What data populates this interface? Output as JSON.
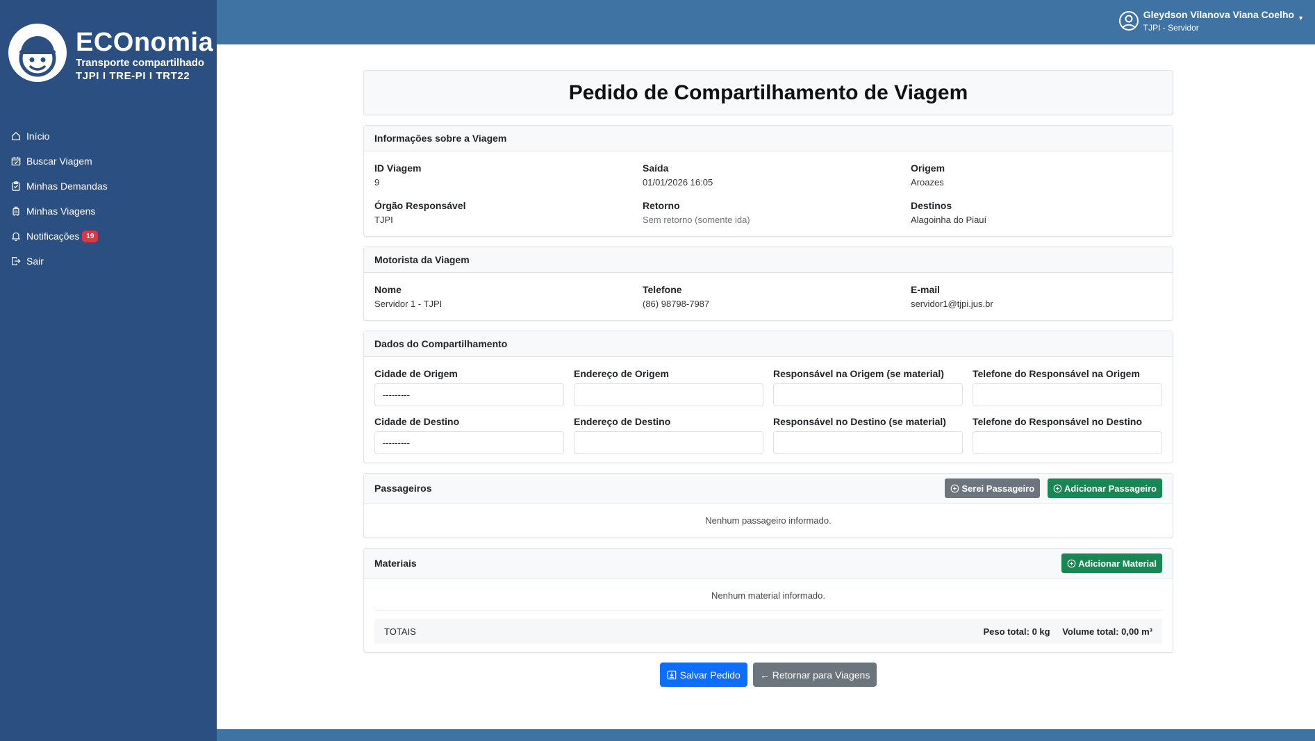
{
  "brand": {
    "title": "ECOnomia",
    "subtitle": "Transporte compartilhado",
    "orgs": "TJPI I TRE-PI I TRT22"
  },
  "sidebar": {
    "items": [
      {
        "label": "Início",
        "icon": "home-icon"
      },
      {
        "label": "Buscar Viagem",
        "icon": "calendar-check-icon"
      },
      {
        "label": "Minhas Demandas",
        "icon": "clipboard-icon"
      },
      {
        "label": "Minhas Viagens",
        "icon": "luggage-icon"
      },
      {
        "label": "Notificações",
        "icon": "bell-icon",
        "badge": "19"
      },
      {
        "label": "Sair",
        "icon": "logout-icon"
      }
    ]
  },
  "user": {
    "name": "Gleydson Vilanova Viana Coelho",
    "role": "TJPI - Servidor"
  },
  "page": {
    "title": "Pedido de Compartilhamento de Viagem"
  },
  "trip_info": {
    "header": "Informações sobre a Viagem",
    "id_label": "ID Viagem",
    "id_value": "9",
    "departure_label": "Saída",
    "departure_value": "01/01/2026 16:05",
    "origin_label": "Origem",
    "origin_value": "Aroazes",
    "org_label": "Órgão Responsável",
    "org_value": "TJPI",
    "return_label": "Retorno",
    "return_value": "Sem retorno (somente ida)",
    "destinations_label": "Destinos",
    "destinations_value": "Alagoinha do Piauí"
  },
  "driver": {
    "header": "Motorista da Viagem",
    "name_label": "Nome",
    "name_value": "Servidor 1 - TJPI",
    "phone_label": "Telefone",
    "phone_value": "(86) 98798-7987",
    "email_label": "E-mail",
    "email_value": "servidor1@tjpi.jus.br"
  },
  "sharing": {
    "header": "Dados do Compartilhamento",
    "origin_city_label": "Cidade de Origem",
    "origin_city_value": "---------",
    "origin_address_label": "Endereço de Origem",
    "origin_address_value": "",
    "origin_resp_label": "Responsável na Origem (se material)",
    "origin_resp_value": "",
    "origin_phone_label": "Telefone do Responsável na Origem",
    "origin_phone_value": "",
    "dest_city_label": "Cidade de Destino",
    "dest_city_value": "---------",
    "dest_address_label": "Endereço de Destino",
    "dest_address_value": "",
    "dest_resp_label": "Responsável no Destino (se material)",
    "dest_resp_value": "",
    "dest_phone_label": "Telefone do Responsável no Destino",
    "dest_phone_value": ""
  },
  "passengers": {
    "header": "Passageiros",
    "self_button": "Serei Passageiro",
    "add_button": "Adicionar Passageiro",
    "empty": "Nenhum passageiro informado."
  },
  "materials": {
    "header": "Materiais",
    "add_button": "Adicionar Material",
    "empty": "Nenhum material informado.",
    "totals_label": "TOTAIS",
    "weight_total": "Peso total: 0 kg",
    "volume_total": "Volume total: 0,00 m³"
  },
  "actions": {
    "save": "Salvar Pedido",
    "back": "← Retornar para Viagens"
  },
  "colors": {
    "sidebar": "#2b4f80",
    "topbar": "#3f73a3",
    "primary": "#0d6efd",
    "success": "#198754",
    "secondary": "#6c757d",
    "danger": "#dc3545"
  }
}
